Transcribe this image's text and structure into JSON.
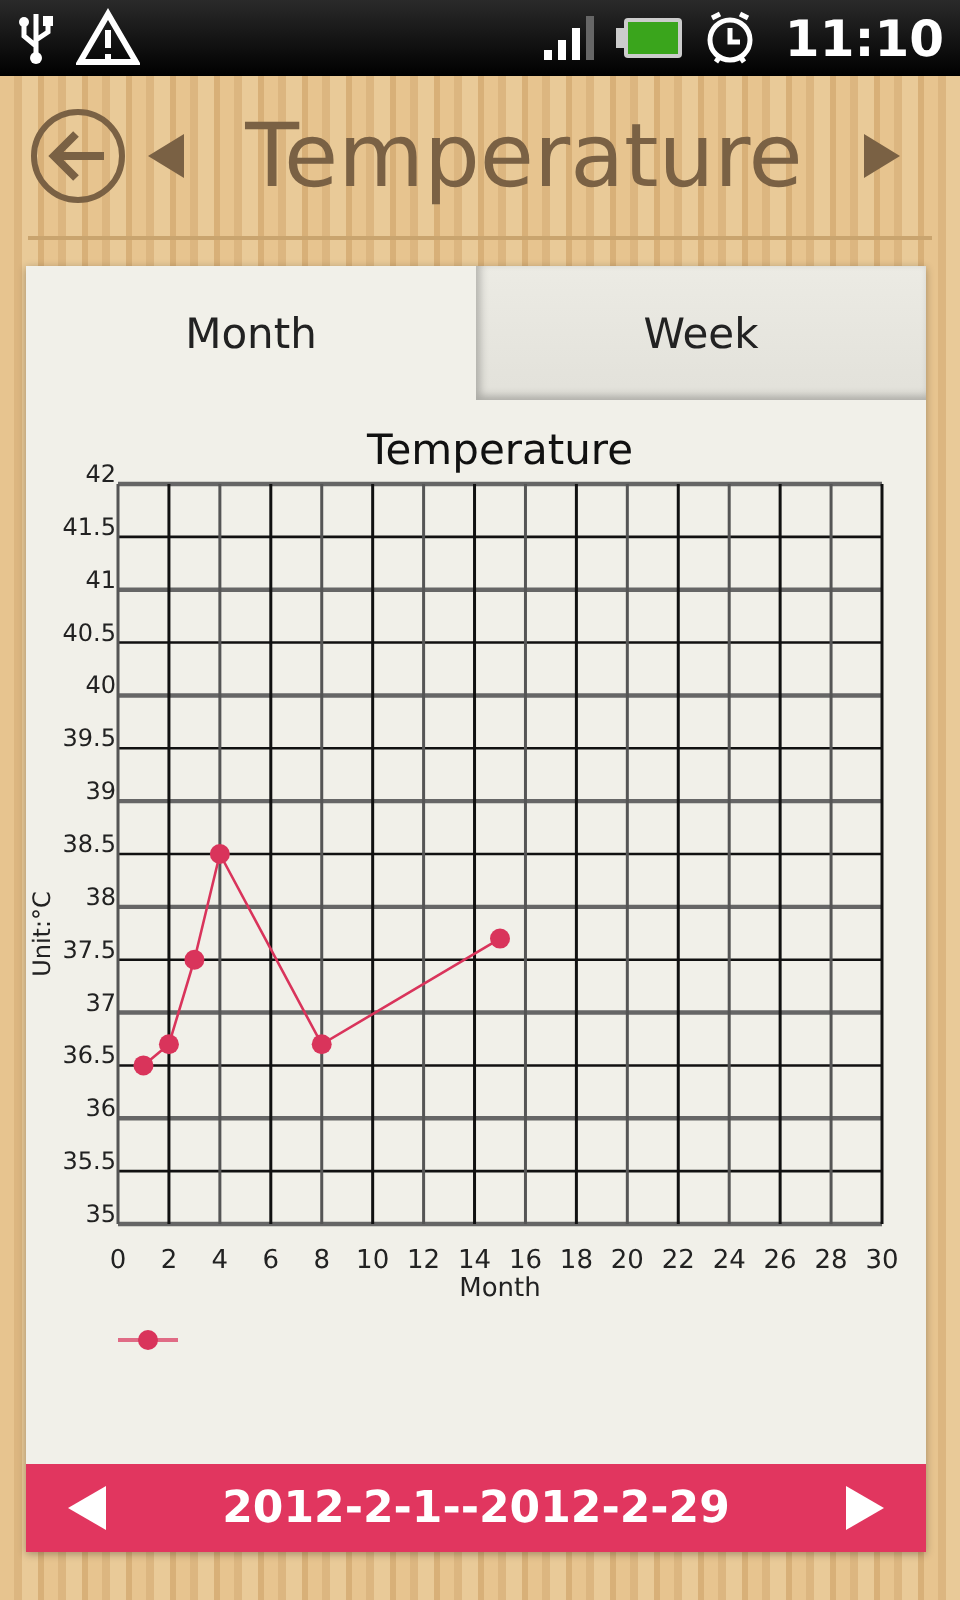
{
  "status_bar": {
    "time": "11:10"
  },
  "header": {
    "title": "Temperature"
  },
  "tabs": [
    {
      "label": "Month",
      "selected": true
    },
    {
      "label": "Week",
      "selected": false
    }
  ],
  "chart": {
    "chart_data": {
      "type": "line",
      "title": "Temperature",
      "xlabel": "Month",
      "ylabel": "Unit:°C",
      "x": [
        1,
        2,
        3,
        4,
        8,
        15
      ],
      "grid": true,
      "series": [
        {
          "color": "#d9345b",
          "marker": "circle",
          "values": [
            36.5,
            36.7,
            37.5,
            38.5,
            36.7,
            37.7
          ]
        }
      ],
      "xlim": [
        0,
        30
      ],
      "ylim": [
        35,
        42
      ],
      "xticks": [
        0,
        2,
        4,
        6,
        8,
        10,
        12,
        14,
        16,
        18,
        20,
        22,
        24,
        26,
        28,
        30
      ],
      "yticks": [
        35,
        35.5,
        36,
        36.5,
        37,
        37.5,
        38,
        38.5,
        39,
        39.5,
        40,
        40.5,
        41,
        41.5,
        42
      ]
    }
  },
  "date_range": "2012-2-1--2012-2-29"
}
